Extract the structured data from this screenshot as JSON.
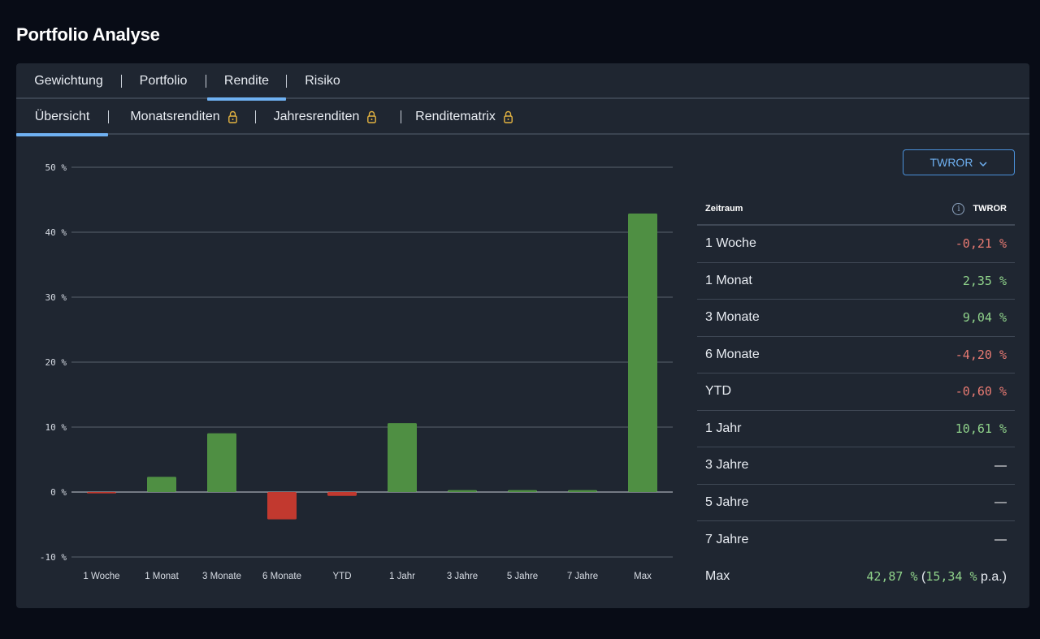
{
  "page_title": "Portfolio Analyse",
  "main_tabs": [
    {
      "label": "Gewichtung",
      "active": false
    },
    {
      "label": "Portfolio",
      "active": false
    },
    {
      "label": "Rendite",
      "active": true
    },
    {
      "label": "Risiko",
      "active": false
    }
  ],
  "sub_tabs": [
    {
      "label": "Übersicht",
      "active": true,
      "locked": false
    },
    {
      "label": "Monatsrenditen",
      "active": false,
      "locked": true
    },
    {
      "label": "Jahresrenditen",
      "active": false,
      "locked": true
    },
    {
      "label": "Renditematrix",
      "active": false,
      "locked": true
    }
  ],
  "dropdown": {
    "label": "TWROR"
  },
  "table": {
    "col_period": "Zeitraum",
    "col_value": "TWROR",
    "rows": [
      {
        "label": "1 Woche",
        "value": "-0,21 %",
        "sign": "neg"
      },
      {
        "label": "1 Monat",
        "value": "2,35 %",
        "sign": "pos"
      },
      {
        "label": "3 Monate",
        "value": "9,04 %",
        "sign": "pos"
      },
      {
        "label": "6 Monate",
        "value": "-4,20 %",
        "sign": "neg"
      },
      {
        "label": "YTD",
        "value": "-0,60 %",
        "sign": "neg"
      },
      {
        "label": "1 Jahr",
        "value": "10,61 %",
        "sign": "pos"
      },
      {
        "label": "3 Jahre",
        "value": "—",
        "sign": "none"
      },
      {
        "label": "5 Jahre",
        "value": "—",
        "sign": "none"
      },
      {
        "label": "7 Jahre",
        "value": "—",
        "sign": "none"
      }
    ],
    "max_row": {
      "label": "Max",
      "value": "42,87 %",
      "pa_value": "15,34 %",
      "pa_suffix": "p.a.)",
      "open_paren": "("
    }
  },
  "colors": {
    "positive": "#4f8f43",
    "negative": "#c2392f",
    "accent": "#6fb1f2"
  },
  "chart_data": {
    "type": "bar",
    "categories": [
      "1 Woche",
      "1 Monat",
      "3 Monate",
      "6 Monate",
      "YTD",
      "1 Jahr",
      "3 Jahre",
      "5 Jahre",
      "7 Jahre",
      "Max"
    ],
    "values": [
      -0.21,
      2.35,
      9.04,
      -4.2,
      -0.6,
      10.61,
      0.3,
      0.3,
      0.3,
      42.87
    ],
    "ylim": [
      -10,
      50
    ],
    "yticks": [
      50,
      40,
      30,
      20,
      10,
      0,
      -10
    ],
    "ytick_labels": [
      "50 %",
      "40 %",
      "30 %",
      "20 %",
      "10 %",
      "0 %",
      "-10 %"
    ],
    "grid": true,
    "title": "",
    "xlabel": "",
    "ylabel": ""
  }
}
